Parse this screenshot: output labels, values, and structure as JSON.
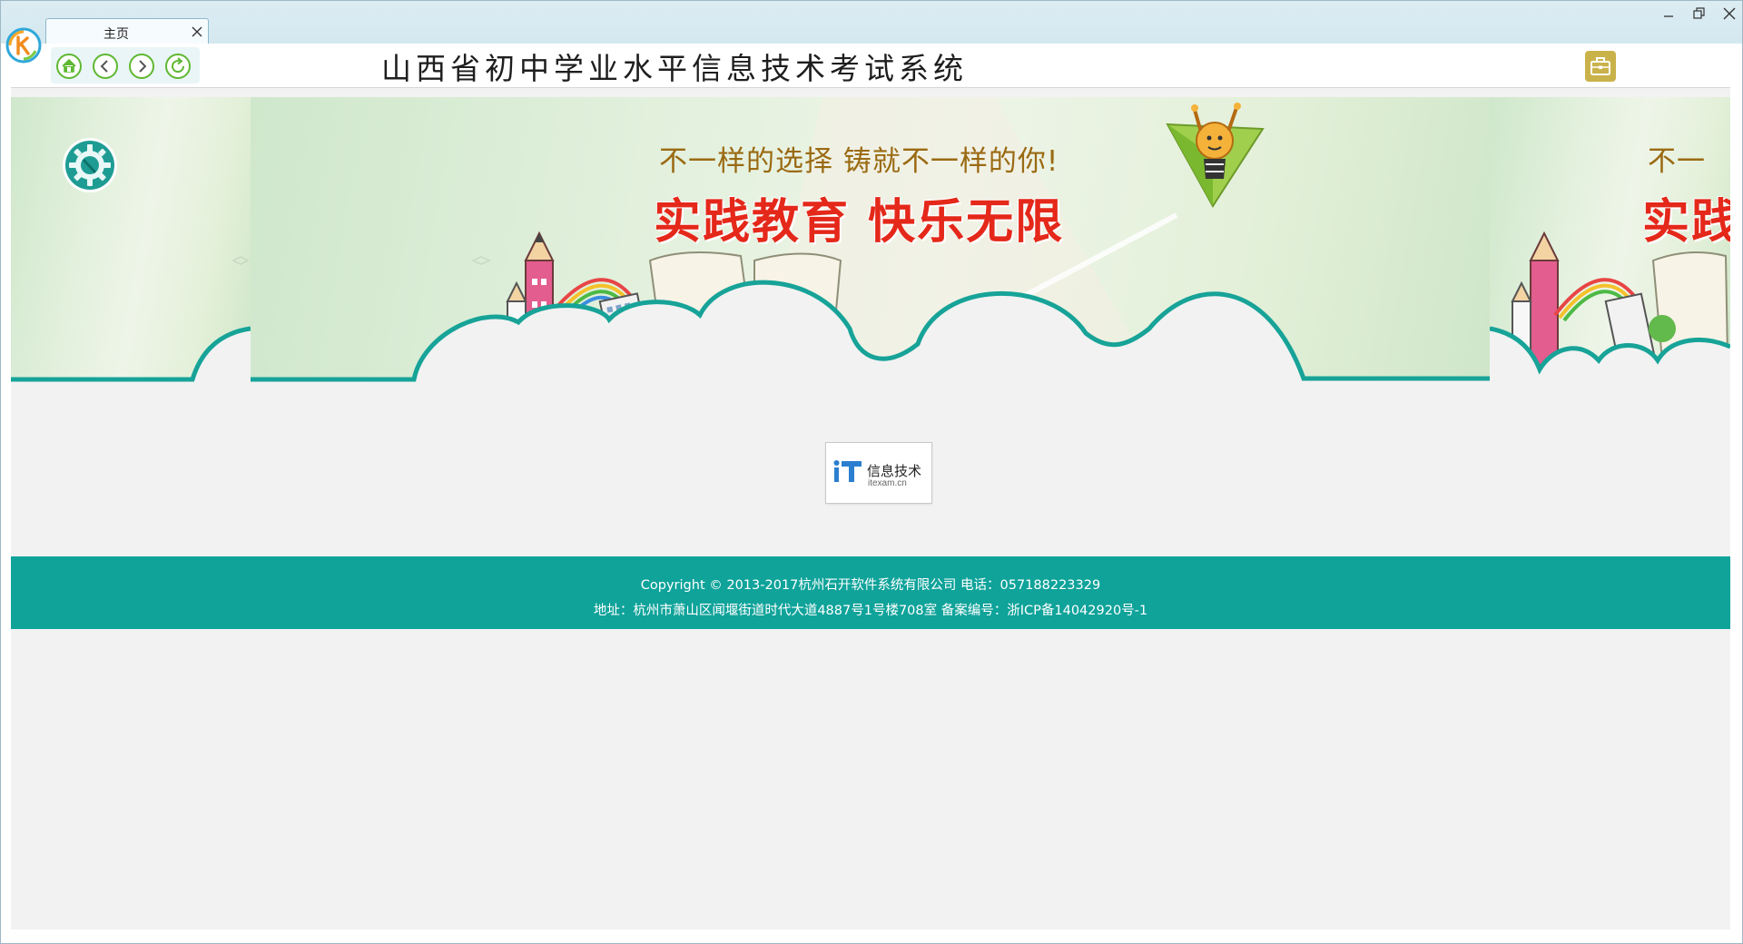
{
  "window": {
    "tab_label": "主页",
    "tab_close_icon": "close-icon",
    "controls": [
      "minimize-icon",
      "restore-icon",
      "close-icon"
    ]
  },
  "toolbar": {
    "nav_icons": [
      "home-icon",
      "back-arrow-icon",
      "forward-arrow-icon",
      "refresh-icon"
    ],
    "title": "山西省初中学业水平信息技术考试系统",
    "toolbox_icon": "toolbox-icon"
  },
  "banner": {
    "slogan_top": "不一样的选择  铸就不一样的你!",
    "slogan_main": "实践教育  快乐无限",
    "slogan_top_partial": "不一",
    "slogan_main_partial": "实践"
  },
  "partner": {
    "mark": "iT",
    "name": "信息技术",
    "domain": "itexam.cn"
  },
  "footer": {
    "line1": "Copyright © 2013-2017杭州石开软件系统有限公司 电话：057188223329",
    "line2": "地址：杭州市萧山区闻堰街道时代大道4887号1号楼708室 备案编号：浙ICP备14042920号-1"
  },
  "colors": {
    "accent_teal": "#0fa39a",
    "slogan_red": "#e4281a",
    "slogan_gold": "#9a6a12",
    "toolbox_gold": "#c9b24a",
    "nav_green": "#5fb832"
  }
}
